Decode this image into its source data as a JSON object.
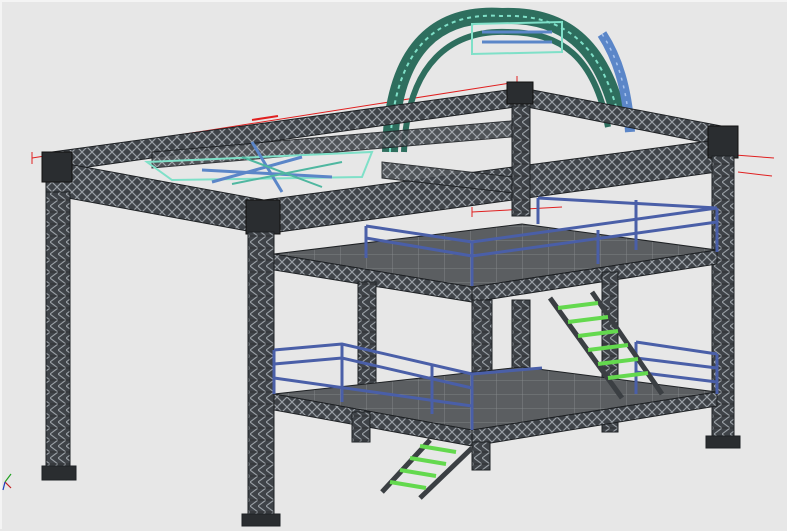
{
  "viewport": {
    "background": "#e7e7e7",
    "colors": {
      "truss": "#3f4348",
      "truss_edge": "#1e2124",
      "truss_lace": "#9aa0a6",
      "deck": "#5b5e61",
      "deck_grid": "#8a8d90",
      "railing": "#4a5fa8",
      "stair_rail": "#3b3f43",
      "stair_tread": "#64d94e",
      "arch": "#2e6e5e",
      "arch_highlight": "#7fe0c8",
      "arch_secondary": "#5b86c8",
      "dimension": "#e02020",
      "axis_x": "#c02020",
      "axis_y": "#20a020"
    },
    "icons": [
      "axis-triad-icon"
    ]
  }
}
